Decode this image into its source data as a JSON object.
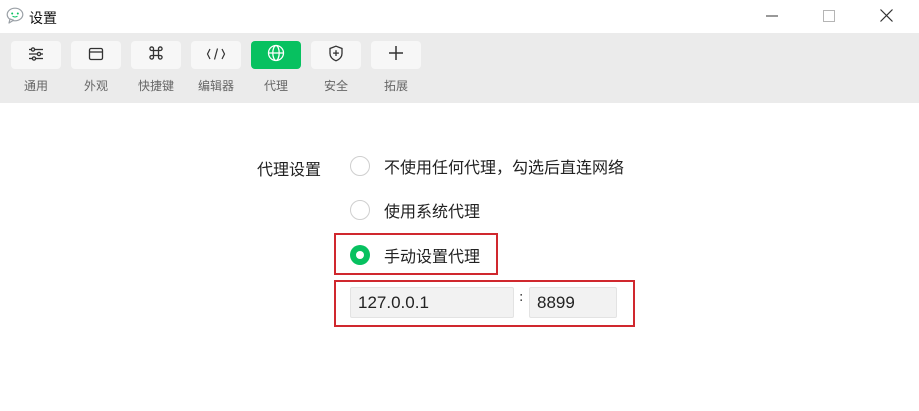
{
  "window": {
    "title": "设置",
    "icon": "chat-bubble-icon",
    "controls": [
      "minimize-icon",
      "maximize-icon",
      "close-icon"
    ]
  },
  "toolbar": {
    "active_color": "#07c160",
    "items": [
      {
        "label": "通用",
        "icon": "sliders-icon",
        "active": false
      },
      {
        "label": "外观",
        "icon": "window-icon",
        "active": false
      },
      {
        "label": "快捷键",
        "icon": "command-key-icon",
        "active": false
      },
      {
        "label": "编辑器",
        "icon": "code-icon",
        "active": false
      },
      {
        "label": "代理",
        "icon": "globe-icon",
        "active": true
      },
      {
        "label": "安全",
        "icon": "shield-icon",
        "active": false
      },
      {
        "label": "拓展",
        "icon": "plus-icon",
        "active": false
      }
    ]
  },
  "proxy": {
    "section_label": "代理设置",
    "options": [
      {
        "label": "不使用任何代理，勾选后直连网络",
        "checked": false
      },
      {
        "label": "使用系统代理",
        "checked": false
      },
      {
        "label": "手动设置代理",
        "checked": true
      }
    ],
    "host": "127.0.0.1",
    "separator": ":",
    "port": "8899",
    "highlight_color": "#d0282e"
  }
}
